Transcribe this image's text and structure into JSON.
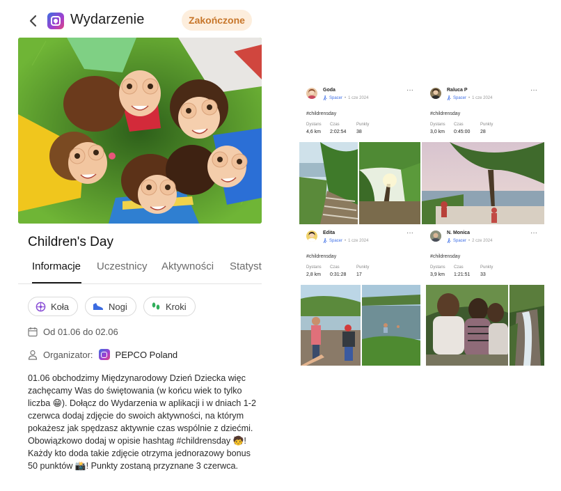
{
  "header": {
    "title": "Wydarzenie",
    "status": "Zakończone"
  },
  "event": {
    "name": "Children's Day",
    "tabs": [
      "Informacje",
      "Uczestnicy",
      "Aktywności",
      "Statyst"
    ],
    "active_tab": "Informacje",
    "categories": [
      {
        "label": "Koła",
        "icon": "wheel-icon"
      },
      {
        "label": "Nogi",
        "icon": "shoe-icon"
      },
      {
        "label": "Kroki",
        "icon": "footsteps-icon"
      }
    ],
    "date_range": "Od 01.06 do 02.06",
    "organizer_label": "Organizator:",
    "organizer_name": "PEPCO Poland",
    "description": "01.06 obchodzimy Międzynarodowy Dzień Dziecka więc zachęcamy Was do świętowania (w końcu wiek to tylko liczba 😁). Dołącz do Wydarzenia w aplikacji i w dniach 1-2 czerwca dodaj zdjęcie do swoich aktywności, na którym pokażesz jak spędzasz aktywnie czas wspólnie z dziećmi. Obowiązkowo dodaj w opisie hashtag #childrensday 🧒! Każdy kto doda takie zdjęcie otrzyma jednorazowy bonus 50 punktów 📸! Punkty zostaną przyznane 3 czerwca."
  },
  "posts": [
    {
      "user": "Goda",
      "type": "Spacer",
      "date": "1 cze 2024",
      "hashtag": "#childrensday",
      "stats": [
        {
          "label": "Dystans",
          "value": "4,6 km"
        },
        {
          "label": "Czas",
          "value": "2:02:54"
        },
        {
          "label": "Punkty",
          "value": "38"
        }
      ],
      "avatar_color": "#e9c7a6"
    },
    {
      "user": "Raluca P",
      "type": "Spacer",
      "date": "1 cze 2024",
      "hashtag": "#childrensday",
      "stats": [
        {
          "label": "Dystans",
          "value": "3,0 km"
        },
        {
          "label": "Czas",
          "value": "0:45:00"
        },
        {
          "label": "Punkty",
          "value": "28"
        }
      ],
      "avatar_color": "#8a7a5a"
    },
    {
      "user": "Edita",
      "type": "Spacer",
      "date": "1 cze 2024",
      "hashtag": "#childrensday",
      "stats": [
        {
          "label": "Dystans",
          "value": "2,8 km"
        },
        {
          "label": "Czas",
          "value": "0:31:28"
        },
        {
          "label": "Punkty",
          "value": "17"
        }
      ],
      "avatar_color": "#f1d36b"
    },
    {
      "user": "N. Monica",
      "type": "Spacer",
      "date": "2 cze 2024",
      "hashtag": "#childrensday",
      "stats": [
        {
          "label": "Dystans",
          "value": "3,9 km"
        },
        {
          "label": "Czas",
          "value": "1:21:51"
        },
        {
          "label": "Punkty",
          "value": "33"
        }
      ],
      "avatar_color": "#6b6f74"
    }
  ],
  "colors": {
    "badge_bg": "#fdeedd",
    "badge_text": "#c7762a",
    "activity_type": "#3d6ee6"
  }
}
